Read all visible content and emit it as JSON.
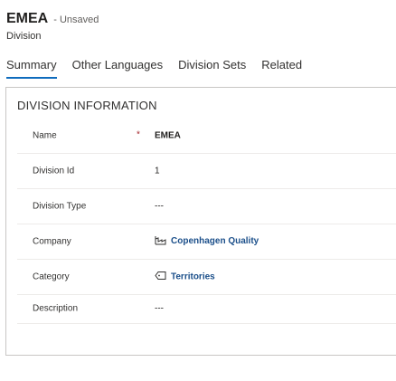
{
  "header": {
    "title": "EMEA",
    "unsaved": "- Unsaved",
    "entity": "Division"
  },
  "tabs": [
    {
      "label": "Summary",
      "active": true
    },
    {
      "label": "Other Languages",
      "active": false
    },
    {
      "label": "Division Sets",
      "active": false
    },
    {
      "label": "Related",
      "active": false
    }
  ],
  "section": {
    "title": "DIVISION INFORMATION",
    "fields": {
      "name": {
        "label": "Name",
        "required": "*",
        "value": "EMEA"
      },
      "division_id": {
        "label": "Division Id",
        "value": "1"
      },
      "division_type": {
        "label": "Division Type",
        "value": "---"
      },
      "company": {
        "label": "Company",
        "value": "Copenhagen Quality",
        "icon": "company-icon"
      },
      "category": {
        "label": "Category",
        "value": "Territories",
        "icon": "tag-icon"
      },
      "description": {
        "label": "Description",
        "value": "---"
      }
    }
  },
  "colors": {
    "accent": "#0f6cbd",
    "link": "#1b4f8a",
    "required": "#a4262c"
  }
}
